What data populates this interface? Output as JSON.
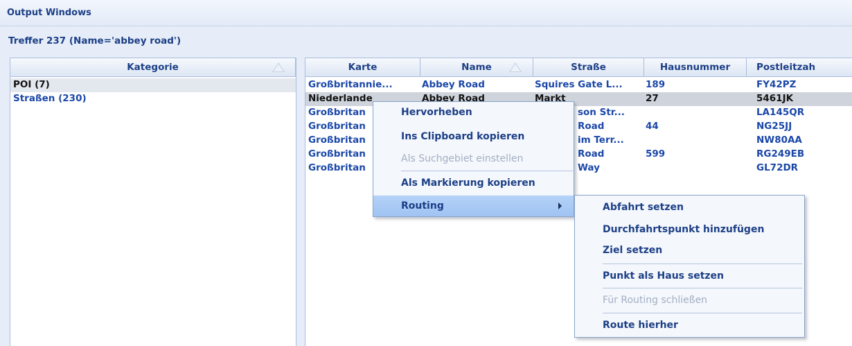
{
  "window": {
    "title": "Output Windows"
  },
  "result": {
    "summary": "Treffer 237  (Name='abbey road')"
  },
  "category_panel": {
    "header": "Kategorie",
    "items": [
      {
        "label": "POI (7)"
      },
      {
        "label": "Straßen (230)"
      }
    ]
  },
  "results_table": {
    "columns": [
      "Karte",
      "Name",
      "Straße",
      "Hausnummer",
      "Postleitzah"
    ],
    "rows": [
      {
        "karte": "Großbritannie...",
        "name": "Abbey Road",
        "strasse": "Squires Gate L...",
        "hausnummer": "189",
        "plz": "FY42PZ"
      },
      {
        "karte": "Niederlande",
        "name": "Abbey Road",
        "strasse": "Markt",
        "hausnummer": "27",
        "plz": "5461JK"
      },
      {
        "karte": "Großbritan",
        "name": "",
        "strasse": "son Str...",
        "hausnummer": "",
        "plz": "LA145QR"
      },
      {
        "karte": "Großbritan",
        "name": "",
        "strasse": "Road",
        "hausnummer": "44",
        "plz": "NG25JJ"
      },
      {
        "karte": "Großbritan",
        "name": "",
        "strasse": "im Terr...",
        "hausnummer": "",
        "plz": "NW80AA"
      },
      {
        "karte": "Großbritan",
        "name": "",
        "strasse": "Road",
        "hausnummer": "599",
        "plz": "RG249EB"
      },
      {
        "karte": "Großbritan",
        "name": "",
        "strasse": "Way",
        "hausnummer": "",
        "plz": "GL72DR"
      }
    ]
  },
  "context_menu": {
    "items": [
      {
        "label": "Hervorheben"
      },
      {
        "label": "Ins Clipboard kopieren"
      },
      {
        "label": "Als Suchgebiet einstellen"
      },
      {
        "label": "Als Markierung kopieren"
      },
      {
        "label": "Routing"
      }
    ]
  },
  "routing_submenu": {
    "items": [
      {
        "label": "Abfahrt setzen"
      },
      {
        "label": "Durchfahrtspunkt hinzufügen"
      },
      {
        "label": "Ziel setzen"
      },
      {
        "label": "Punkt als Haus setzen"
      },
      {
        "label": "Für Routing schließen"
      },
      {
        "label": "Route hierher"
      }
    ]
  }
}
